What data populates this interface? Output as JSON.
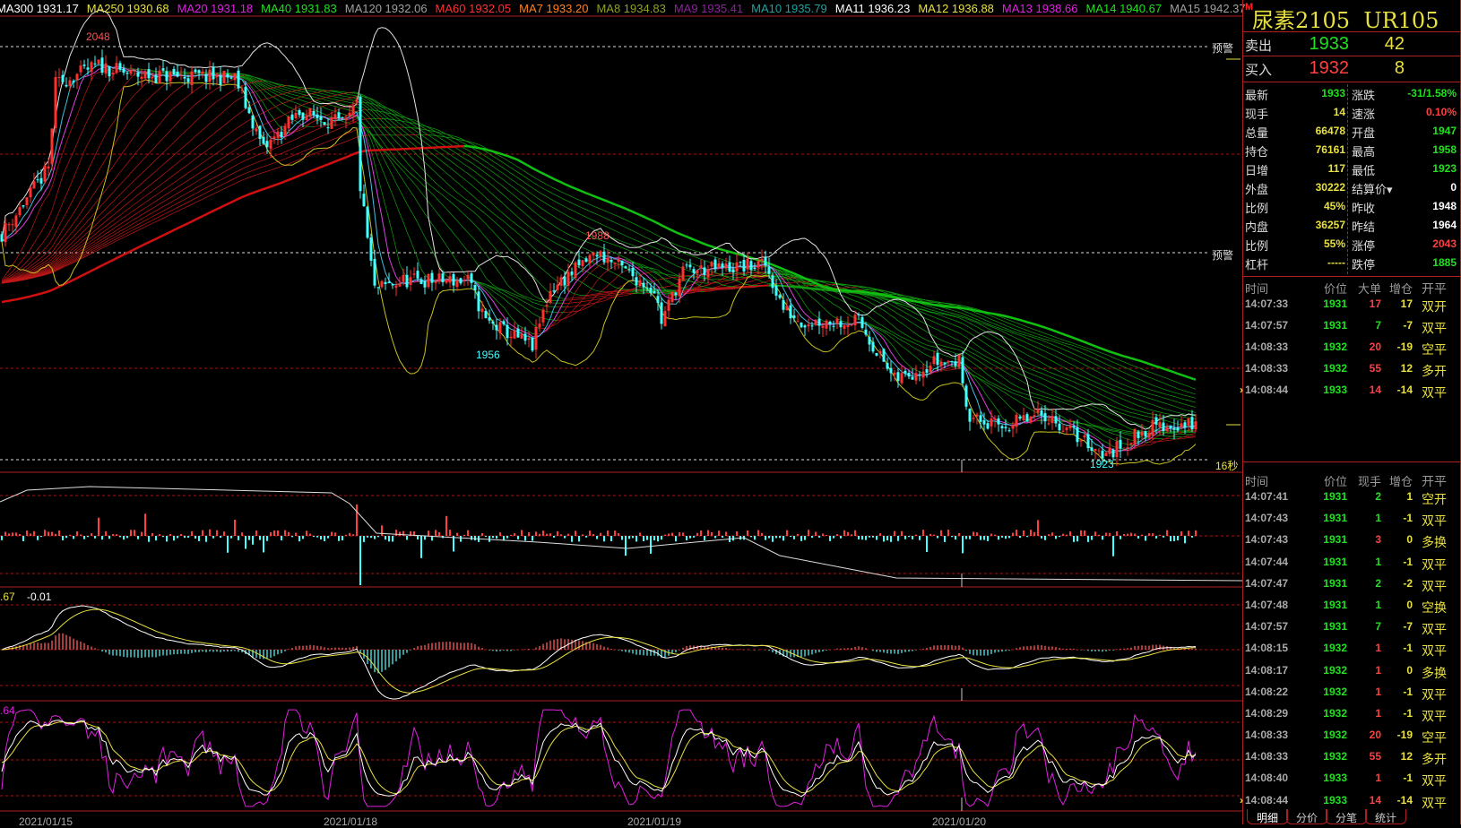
{
  "ma_legend": [
    {
      "label": "MA300 1931.17",
      "color": "#ffffff"
    },
    {
      "label": "MA250 1930.68",
      "color": "#e8e040"
    },
    {
      "label": "MA20 1931.18",
      "color": "#e020e0"
    },
    {
      "label": "MA40 1931.83",
      "color": "#20e020"
    },
    {
      "label": "MA120 1932.06",
      "color": "#a0a0a0"
    },
    {
      "label": "MA60 1932.05",
      "color": "#ff3030"
    },
    {
      "label": "MA7 1933.20",
      "color": "#ff8020"
    },
    {
      "label": "MA8 1934.83",
      "color": "#90a020"
    },
    {
      "label": "MA9 1935.41",
      "color": "#9020a0"
    },
    {
      "label": "MA10 1935.79",
      "color": "#20a0a0"
    },
    {
      "label": "MA11 1936.23",
      "color": "#ffffff"
    },
    {
      "label": "MA12 1936.88",
      "color": "#e8e040"
    },
    {
      "label": "MA13 1938.66",
      "color": "#e020e0"
    },
    {
      "label": "MA14 1940.67",
      "color": "#20e020"
    },
    {
      "label": "MA15 1942.37",
      "color": "#a0a0a0"
    }
  ],
  "chart_labels": {
    "high": "2048",
    "peak2": "1988",
    "low1": "1956",
    "low": "1923",
    "alert1": "预警",
    "alert2": "预警",
    "timer": "16秒",
    "macd_a": ".67",
    "macd_b": "-0.01",
    "kdj_a": ".64"
  },
  "dates": [
    "2021/01/15",
    "2021/01/18",
    "2021/01/19",
    "2021/01/20"
  ],
  "colors": {
    "up": "#ff3030",
    "down": "#40ffff",
    "grid": "#a01818"
  },
  "price_path": [
    [
      0,
      1994
    ],
    [
      13,
      2015
    ],
    [
      15,
      2042
    ],
    [
      27,
      2048
    ],
    [
      36,
      2045
    ],
    [
      65,
      2044
    ],
    [
      73,
      2021
    ],
    [
      83,
      2033
    ],
    [
      96,
      2029
    ],
    [
      99,
      2036
    ],
    [
      100,
      2009
    ],
    [
      104,
      1976
    ],
    [
      112,
      1979
    ],
    [
      130,
      1979
    ],
    [
      135,
      1966
    ],
    [
      148,
      1958
    ],
    [
      153,
      1976
    ],
    [
      166,
      1988
    ],
    [
      182,
      1976
    ],
    [
      184,
      1966
    ],
    [
      190,
      1982
    ],
    [
      213,
      1984
    ],
    [
      218,
      1970
    ],
    [
      223,
      1966
    ],
    [
      239,
      1966
    ],
    [
      249,
      1947
    ],
    [
      260,
      1953
    ],
    [
      267,
      1953
    ],
    [
      270,
      1935
    ],
    [
      278,
      1932
    ],
    [
      291,
      1936
    ],
    [
      308,
      1923
    ],
    [
      320,
      1932
    ],
    [
      333,
      1933
    ]
  ],
  "header": {
    "badge": "M",
    "symbol": "尿素2105",
    "code": "UR105"
  },
  "quote": {
    "ask": {
      "label": "卖出",
      "price": "1933",
      "vol": "42"
    },
    "bid": {
      "label": "买入",
      "price": "1932",
      "vol": "8"
    }
  },
  "stats": [
    {
      "l": "最新",
      "v": "1933",
      "vc": "#20e020",
      "l2": "涨跌",
      "v2": "-31/1.58%",
      "v2c": "#20e020"
    },
    {
      "l": "现手",
      "v": "14",
      "vc": "#e8e040",
      "l2": "速涨",
      "v2": "0.10%",
      "v2c": "#ff4040"
    },
    {
      "l": "总量",
      "v": "66478",
      "vc": "#e8e040",
      "l2": "开盘",
      "v2": "1947",
      "v2c": "#20e020"
    },
    {
      "l": "持仓",
      "v": "76161",
      "vc": "#e8e040",
      "l2": "最高",
      "v2": "1958",
      "v2c": "#20e020"
    },
    {
      "l": "日增",
      "v": "117",
      "vc": "#e8e040",
      "l2": "最低",
      "v2": "1923",
      "v2c": "#20e020"
    },
    {
      "l": "外盘",
      "v": "30222",
      "vc": "#e8e040",
      "l2": "结算价▾",
      "v2": "0",
      "v2c": "#ffffff"
    },
    {
      "l": "比例",
      "v": "45%",
      "vc": "#e8e040",
      "l2": "昨收",
      "v2": "1948",
      "v2c": "#ffffff"
    },
    {
      "l": "内盘",
      "v": "36257",
      "vc": "#e8e040",
      "l2": "昨结",
      "v2": "1964",
      "v2c": "#ffffff"
    },
    {
      "l": "比例",
      "v": "55%",
      "vc": "#e8e040",
      "l2": "涨停",
      "v2": "2043",
      "v2c": "#ff4040"
    },
    {
      "l": "杠杆",
      "v": "-----",
      "vc": "#e8e040",
      "l2": "跌停",
      "v2": "1885",
      "v2c": "#20e020"
    }
  ],
  "big_orders": {
    "header": [
      "时间",
      "价位",
      "大单",
      "增仓",
      "开平"
    ],
    "rows": [
      {
        "t": "14:07:33",
        "p": "1931",
        "v": "17",
        "vc": "#ff4040",
        "d": "17",
        "k": "双开"
      },
      {
        "t": "14:07:57",
        "p": "1931",
        "v": "7",
        "vc": "#20e020",
        "d": "-7",
        "k": "双平"
      },
      {
        "t": "14:08:33",
        "p": "1932",
        "v": "20",
        "vc": "#ff4040",
        "d": "-19",
        "k": "空平"
      },
      {
        "t": "14:08:33",
        "p": "1932",
        "v": "55",
        "vc": "#ff4040",
        "d": "12",
        "k": "多开"
      },
      {
        "t": "14:08:44",
        "p": "1933",
        "v": "14",
        "vc": "#ff4040",
        "d": "-14",
        "k": "双平",
        "cur": true
      }
    ]
  },
  "ticks": {
    "header": [
      "时间",
      "价位",
      "现手",
      "增仓",
      "开平"
    ],
    "rows": [
      {
        "t": "14:07:41",
        "p": "1931",
        "v": "2",
        "vc": "#20e020",
        "d": "1",
        "k": "空开"
      },
      {
        "t": "14:07:43",
        "p": "1931",
        "v": "1",
        "vc": "#20e020",
        "d": "-1",
        "k": "双平"
      },
      {
        "t": "14:07:43",
        "p": "1931",
        "v": "3",
        "vc": "#ff4040",
        "d": "0",
        "k": "多换"
      },
      {
        "t": "14:07:44",
        "p": "1931",
        "v": "1",
        "vc": "#20e020",
        "d": "-1",
        "k": "双平"
      },
      {
        "t": "14:07:47",
        "p": "1931",
        "v": "2",
        "vc": "#20e020",
        "d": "-2",
        "k": "双平"
      },
      {
        "t": "14:07:48",
        "p": "1931",
        "v": "1",
        "vc": "#20e020",
        "d": "0",
        "k": "空换"
      },
      {
        "t": "14:07:57",
        "p": "1931",
        "v": "7",
        "vc": "#20e020",
        "d": "-7",
        "k": "双平"
      },
      {
        "t": "14:08:15",
        "p": "1932",
        "v": "1",
        "vc": "#ff4040",
        "d": "-1",
        "k": "双平"
      },
      {
        "t": "14:08:17",
        "p": "1932",
        "v": "1",
        "vc": "#ff4040",
        "d": "0",
        "k": "多换"
      },
      {
        "t": "14:08:22",
        "p": "1932",
        "v": "1",
        "vc": "#ff4040",
        "d": "-1",
        "k": "双平"
      },
      {
        "t": "14:08:29",
        "p": "1932",
        "v": "1",
        "vc": "#ff4040",
        "d": "-1",
        "k": "双平"
      },
      {
        "t": "14:08:33",
        "p": "1932",
        "v": "20",
        "vc": "#ff4040",
        "d": "-19",
        "k": "空平"
      },
      {
        "t": "14:08:33",
        "p": "1932",
        "v": "55",
        "vc": "#ff4040",
        "d": "12",
        "k": "多开"
      },
      {
        "t": "14:08:40",
        "p": "1933",
        "v": "1",
        "vc": "#ff4040",
        "d": "-1",
        "k": "双平"
      },
      {
        "t": "14:08:44",
        "p": "1933",
        "v": "14",
        "vc": "#ff4040",
        "d": "-14",
        "k": "双平",
        "cur": true
      }
    ]
  },
  "tabs": [
    "明细",
    "分价",
    "分笔",
    "统计"
  ]
}
